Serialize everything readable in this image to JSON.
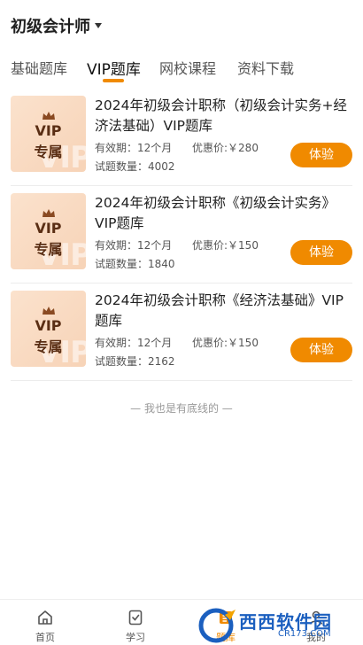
{
  "header": {
    "title": "初级会计师"
  },
  "tabs": [
    {
      "label": "基础题库"
    },
    {
      "label": "VIP题库",
      "active": true
    },
    {
      "label": "网校课程"
    },
    {
      "label": "资料下载"
    }
  ],
  "accent_color": "#f08a00",
  "products": [
    {
      "thumb_vip": "VIP",
      "thumb_label": "专属",
      "title": "2024年初级会计职称（初级会计实务+经济法基础）VIP题库",
      "validity": "有效期：12个月",
      "price": "优惠价:￥280",
      "count": "试题数量：4002",
      "button": "体验"
    },
    {
      "thumb_vip": "VIP",
      "thumb_label": "专属",
      "title": "2024年初级会计职称《初级会计实务》VIP题库",
      "validity": "有效期：12个月",
      "price": "优惠价:￥150",
      "count": "试题数量：1840",
      "button": "体验"
    },
    {
      "thumb_vip": "VIP",
      "thumb_label": "专属",
      "title": "2024年初级会计职称《经济法基础》VIP题库",
      "validity": "有效期：12个月",
      "price": "优惠价:￥150",
      "count": "试题数量：2162",
      "button": "体验"
    }
  ],
  "end_text": "— 我也是有底线的 —",
  "bottom_nav": [
    {
      "label": "首页",
      "icon": "home-icon"
    },
    {
      "label": "学习",
      "icon": "study-icon"
    },
    {
      "label": "题库",
      "icon": "question-bank-icon",
      "active": true
    },
    {
      "label": "我的",
      "icon": "profile-icon"
    }
  ],
  "watermark": {
    "text": "西西软件园",
    "sub": "CR173.COM"
  }
}
